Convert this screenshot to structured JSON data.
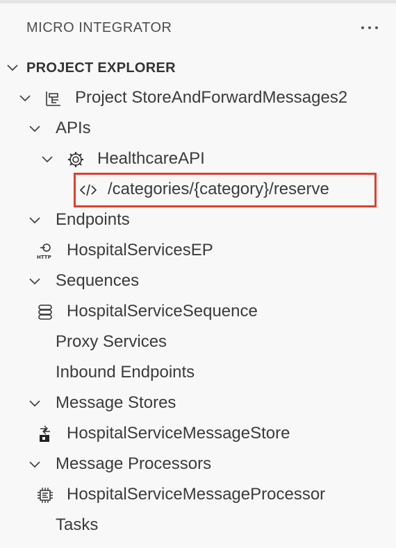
{
  "panel": {
    "title": "MICRO INTEGRATOR"
  },
  "explorer": {
    "title": "PROJECT EXPLORER"
  },
  "tree": {
    "project": "Project StoreAndForwardMessages2",
    "apis": "APIs",
    "healthcare_api": "HealthcareAPI",
    "resource": "/categories/{category}/reserve",
    "endpoints": "Endpoints",
    "hospital_ep": "HospitalServicesEP",
    "sequences": "Sequences",
    "hospital_seq": "HospitalServiceSequence",
    "proxy_services": "Proxy Services",
    "inbound_endpoints": "Inbound Endpoints",
    "message_stores": "Message Stores",
    "hospital_store": "HospitalServiceMessageStore",
    "message_processors": "Message Processors",
    "hospital_processor": "HospitalServiceMessageProcessor",
    "tasks": "Tasks"
  },
  "icons": {
    "project": "project-structure-icon",
    "api": "gear-icon",
    "resource": "code-icon",
    "endpoint": "http-endpoint-icon",
    "sequence": "sequence-icon",
    "store": "message-store-icon",
    "processor": "message-processor-icon",
    "more": "ellipsis-icon"
  },
  "colors": {
    "highlight": "#e0402f",
    "background": "#f8f8f8",
    "text": "#3b3b3b"
  }
}
